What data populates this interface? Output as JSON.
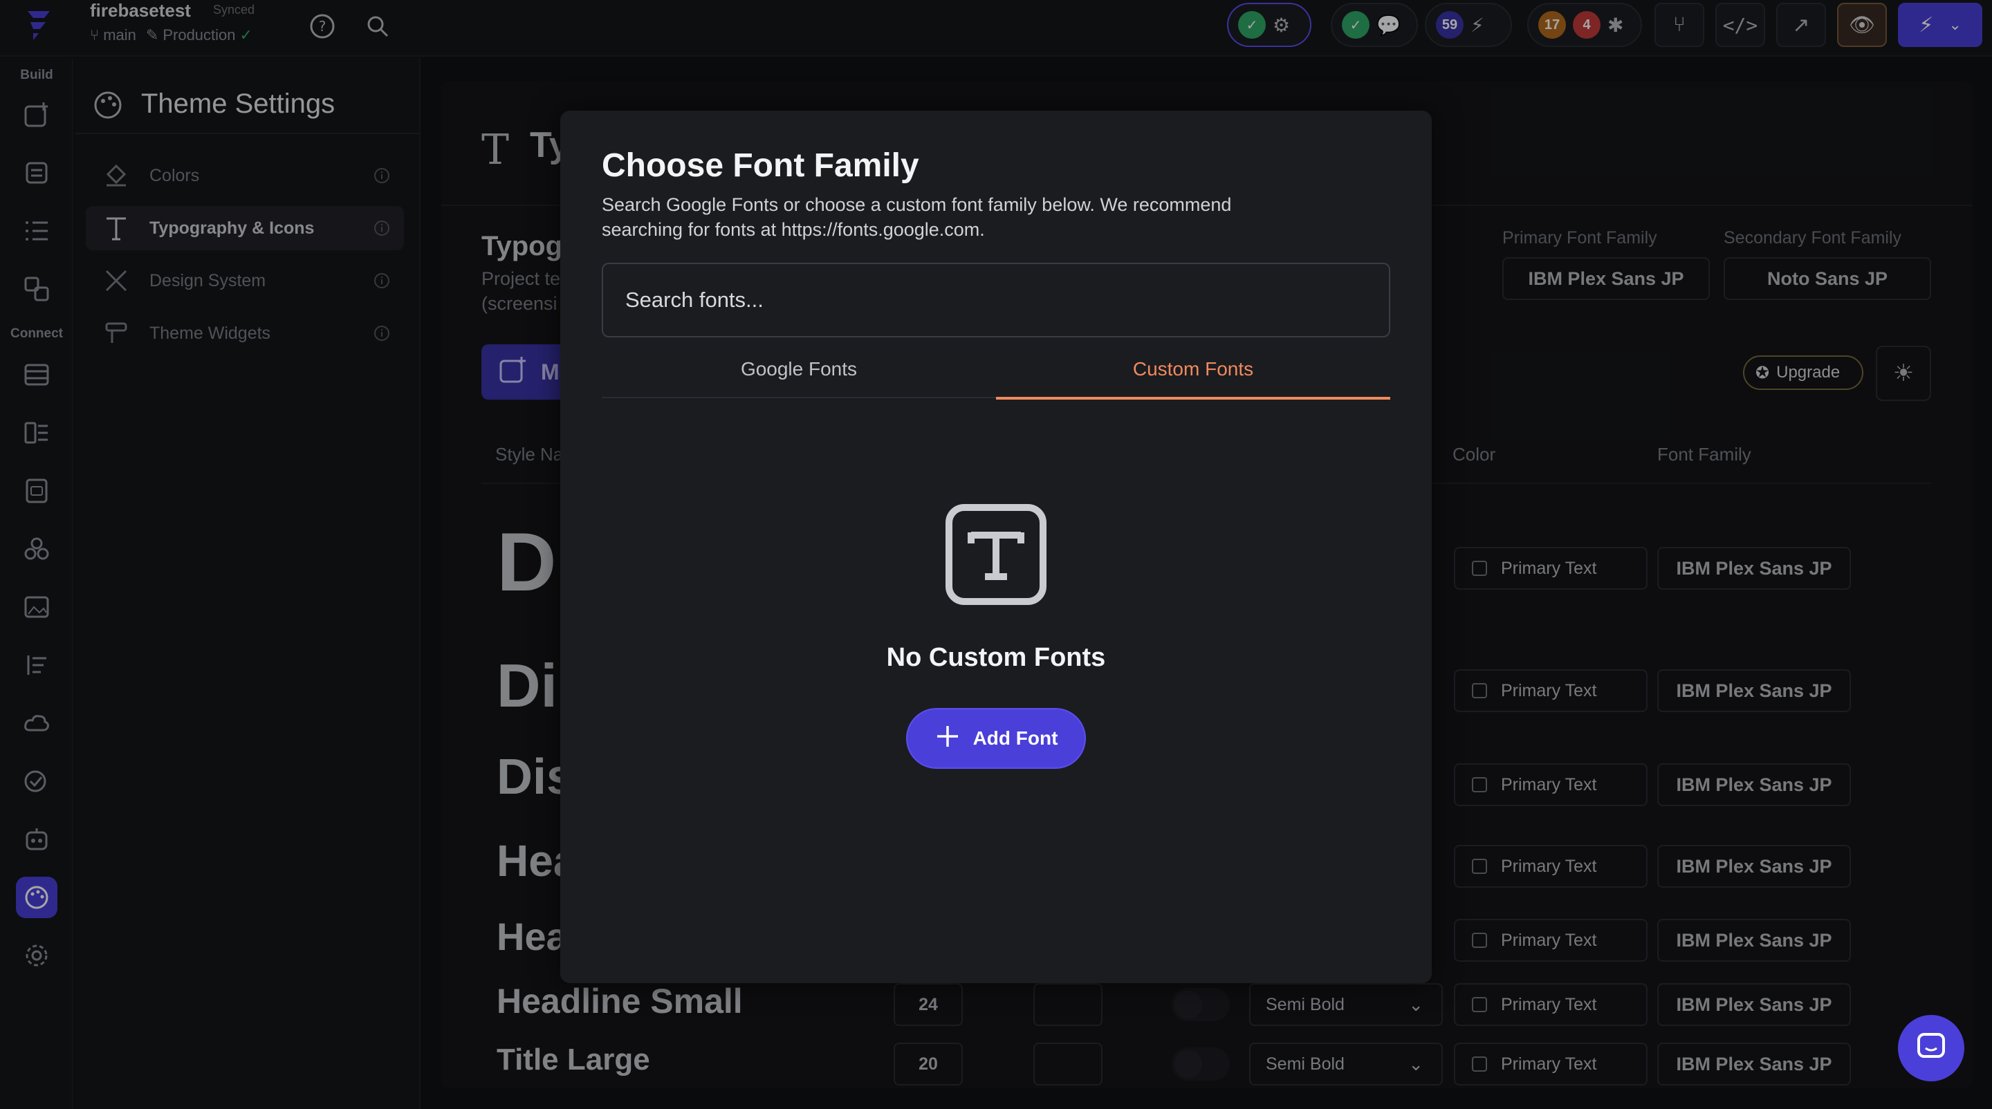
{
  "topbar": {
    "project_name": "firebasetest",
    "sync_status": "Synced",
    "branch": "main",
    "environment": "Production",
    "badges": {
      "count_a": "59",
      "count_b": "17",
      "count_c": "4"
    }
  },
  "rail": {
    "build_label": "Build",
    "connect_label": "Connect"
  },
  "settings": {
    "title": "Theme Settings",
    "items": [
      {
        "label": "Colors"
      },
      {
        "label": "Typography & Icons"
      },
      {
        "label": "Design System"
      },
      {
        "label": "Theme Widgets"
      }
    ]
  },
  "main": {
    "title_fragment": "Ty",
    "section_title_fragment": "Typog",
    "desc_line1": "Project te",
    "desc_line2": "(screensi",
    "button_fragment": "M",
    "primary_font_label": "Primary Font Family",
    "secondary_font_label": "Secondary Font Family",
    "primary_font": "IBM Plex Sans JP",
    "secondary_font": "Noto Sans JP",
    "upgrade_label": "Upgrade",
    "columns": {
      "style_name": "Style Na",
      "color": "Color",
      "font_family": "Font Family"
    },
    "rows": [
      {
        "name": "D",
        "color": "Primary Text",
        "font": "IBM Plex Sans JP"
      },
      {
        "name": "Di",
        "color": "Primary Text",
        "font": "IBM Plex Sans JP"
      },
      {
        "name": "Dis",
        "color": "Primary Text",
        "font": "IBM Plex Sans JP"
      },
      {
        "name": "Hea",
        "color": "Primary Text",
        "font": "IBM Plex Sans JP"
      },
      {
        "name": "Hea",
        "color": "Primary Text",
        "font": "IBM Plex Sans JP"
      },
      {
        "name": "Headline Small",
        "size": "24",
        "weight": "Semi Bold",
        "color": "Primary Text",
        "font": "IBM Plex Sans JP"
      },
      {
        "name": "Title Large",
        "size": "20",
        "weight": "Semi Bold",
        "color": "Primary Text",
        "font": "IBM Plex Sans JP"
      }
    ]
  },
  "modal": {
    "title": "Choose Font Family",
    "description": "Search Google Fonts or choose a custom font family below. We recommend searching for fonts at https://fonts.google.com.",
    "search_placeholder": "Search fonts...",
    "tabs": {
      "google": "Google Fonts",
      "custom": "Custom Fonts"
    },
    "active_tab": "Custom Fonts",
    "empty_title": "No Custom Fonts",
    "add_button": "Add Font"
  },
  "colors": {
    "accent": "#4b3fd9",
    "tab_active": "#f08a5d",
    "success": "#2ea868"
  }
}
